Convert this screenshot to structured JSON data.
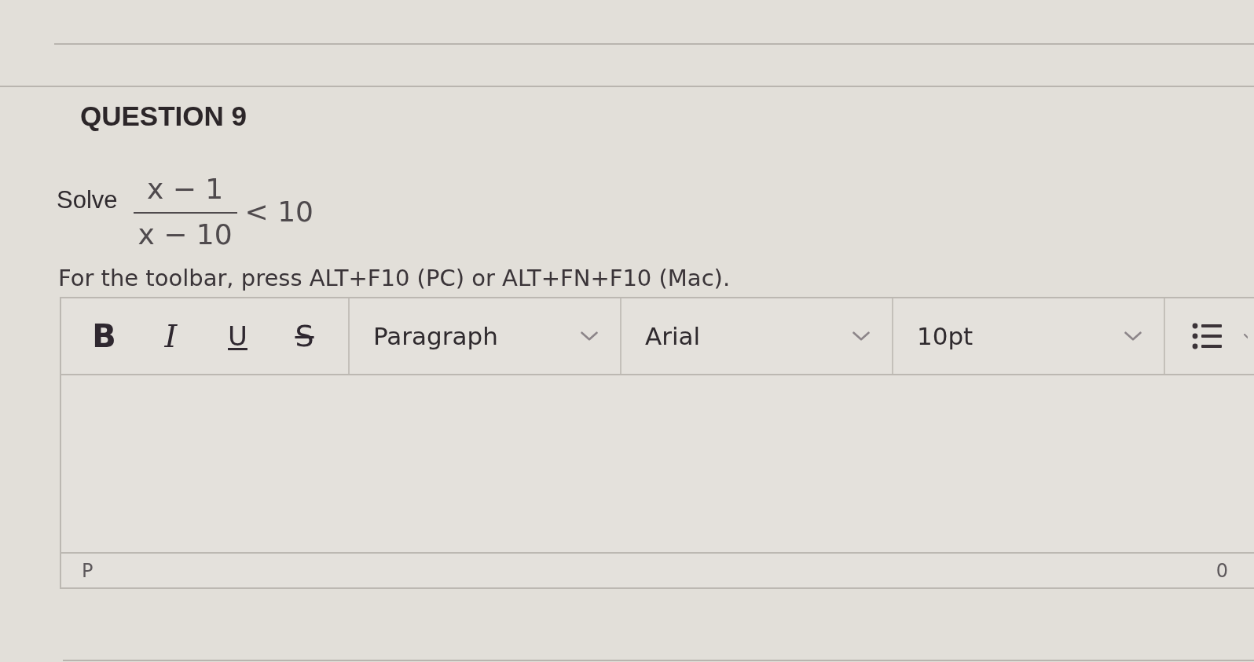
{
  "question": {
    "title": "QUESTION 9",
    "prompt": "Solve",
    "inequality": {
      "numerator": "x − 1",
      "denominator": "x − 10",
      "relation": "< 10"
    },
    "instructions": "For the toolbar, press ALT+F10 (PC) or ALT+FN+F10 (Mac)."
  },
  "editor": {
    "toolbar": {
      "format_buttons": [
        {
          "kind": "bold",
          "label": "B"
        },
        {
          "kind": "italic",
          "label": "I"
        },
        {
          "kind": "underline",
          "label": "U"
        },
        {
          "kind": "strikethrough",
          "label": "S"
        }
      ],
      "dropdowns": [
        {
          "value": "Paragraph"
        },
        {
          "value": "Arial"
        },
        {
          "value": "10pt"
        }
      ]
    },
    "status_bar": {
      "element_path": "P",
      "word_count": "0"
    }
  }
}
